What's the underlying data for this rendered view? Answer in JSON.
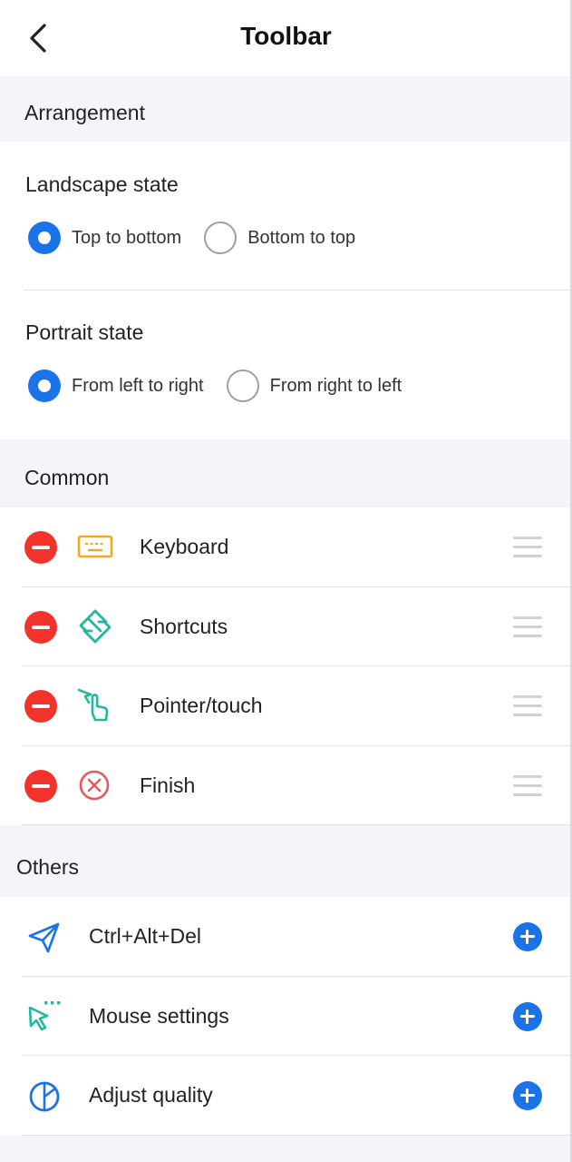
{
  "header": {
    "title": "Toolbar",
    "back_icon": "chevron-left-icon"
  },
  "arrangement": {
    "section_label": "Arrangement",
    "landscape": {
      "title": "Landscape state",
      "options": [
        {
          "label": "Top to bottom",
          "selected": true
        },
        {
          "label": "Bottom to top",
          "selected": false
        }
      ]
    },
    "portrait": {
      "title": "Portrait state",
      "options": [
        {
          "label": "From left to right",
          "selected": true
        },
        {
          "label": "From right to left",
          "selected": false
        }
      ]
    }
  },
  "common": {
    "section_label": "Common",
    "items": [
      {
        "label": "Keyboard",
        "icon": "keyboard-icon",
        "color": "#f0a81c"
      },
      {
        "label": "Shortcuts",
        "icon": "shortcuts-icon",
        "color": "#22b8a0"
      },
      {
        "label": "Pointer/touch",
        "icon": "pointer-touch-icon",
        "color": "#22b8a0"
      },
      {
        "label": "Finish",
        "icon": "finish-x-icon",
        "color": "#e55b5b"
      }
    ]
  },
  "others": {
    "section_label": "Others",
    "items": [
      {
        "label": "Ctrl+Alt+Del",
        "icon": "send-icon",
        "color": "#1a73e8"
      },
      {
        "label": "Mouse settings",
        "icon": "mouse-cursor-icon",
        "color": "#22b8a0"
      },
      {
        "label": "Adjust quality",
        "icon": "quality-icon",
        "color": "#1a73e8"
      }
    ]
  },
  "colors": {
    "accent": "#1a73e8",
    "remove": "#f2332b",
    "background": "#f4f5f8"
  }
}
